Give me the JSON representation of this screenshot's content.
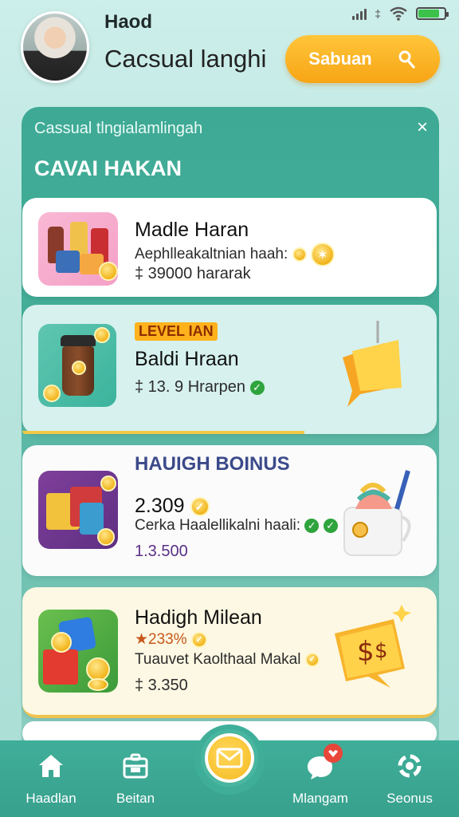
{
  "status": {
    "signal_label": "‡",
    "battery_percent": 80
  },
  "header": {
    "name": "Haod",
    "subtitle": "Cacsual langhi",
    "button_label": "Sabuan"
  },
  "panel": {
    "subtitle": "Cassual tlngialamlingah",
    "title": "CAVAI HAKAN",
    "close_label": "×"
  },
  "cards": [
    {
      "title": "Madle Haran",
      "desc": "Aephlleakaltnian haah:",
      "value": "‡ 39000 hararak"
    },
    {
      "badge": "LEVEL IAN",
      "title": "Baldi Hraan",
      "value": "‡ 13. 9 Hrarpen",
      "progress_percent": 68
    },
    {
      "heading": "HAUIGH BOINUS",
      "title": "2.309",
      "desc": "Cerka Haalellikalni haali:",
      "value": "1.3.500"
    },
    {
      "title": "Hadigh Milean",
      "pct": "★233%",
      "desc": "Tuauvet Kaolthaal Makal",
      "value": "‡ 3.350"
    }
  ],
  "nav": {
    "items": [
      {
        "label": "Haadlan",
        "icon": "home-icon"
      },
      {
        "label": "Beitan",
        "icon": "briefcase-icon"
      },
      {
        "label": "Mlangam",
        "icon": "chat-icon"
      },
      {
        "label": "Seonus",
        "icon": "settings-icon"
      }
    ],
    "center_icon": "mail-icon"
  },
  "colors": {
    "accent": "#3fae99",
    "button": "#f7a515",
    "progress": "#f1c846"
  }
}
